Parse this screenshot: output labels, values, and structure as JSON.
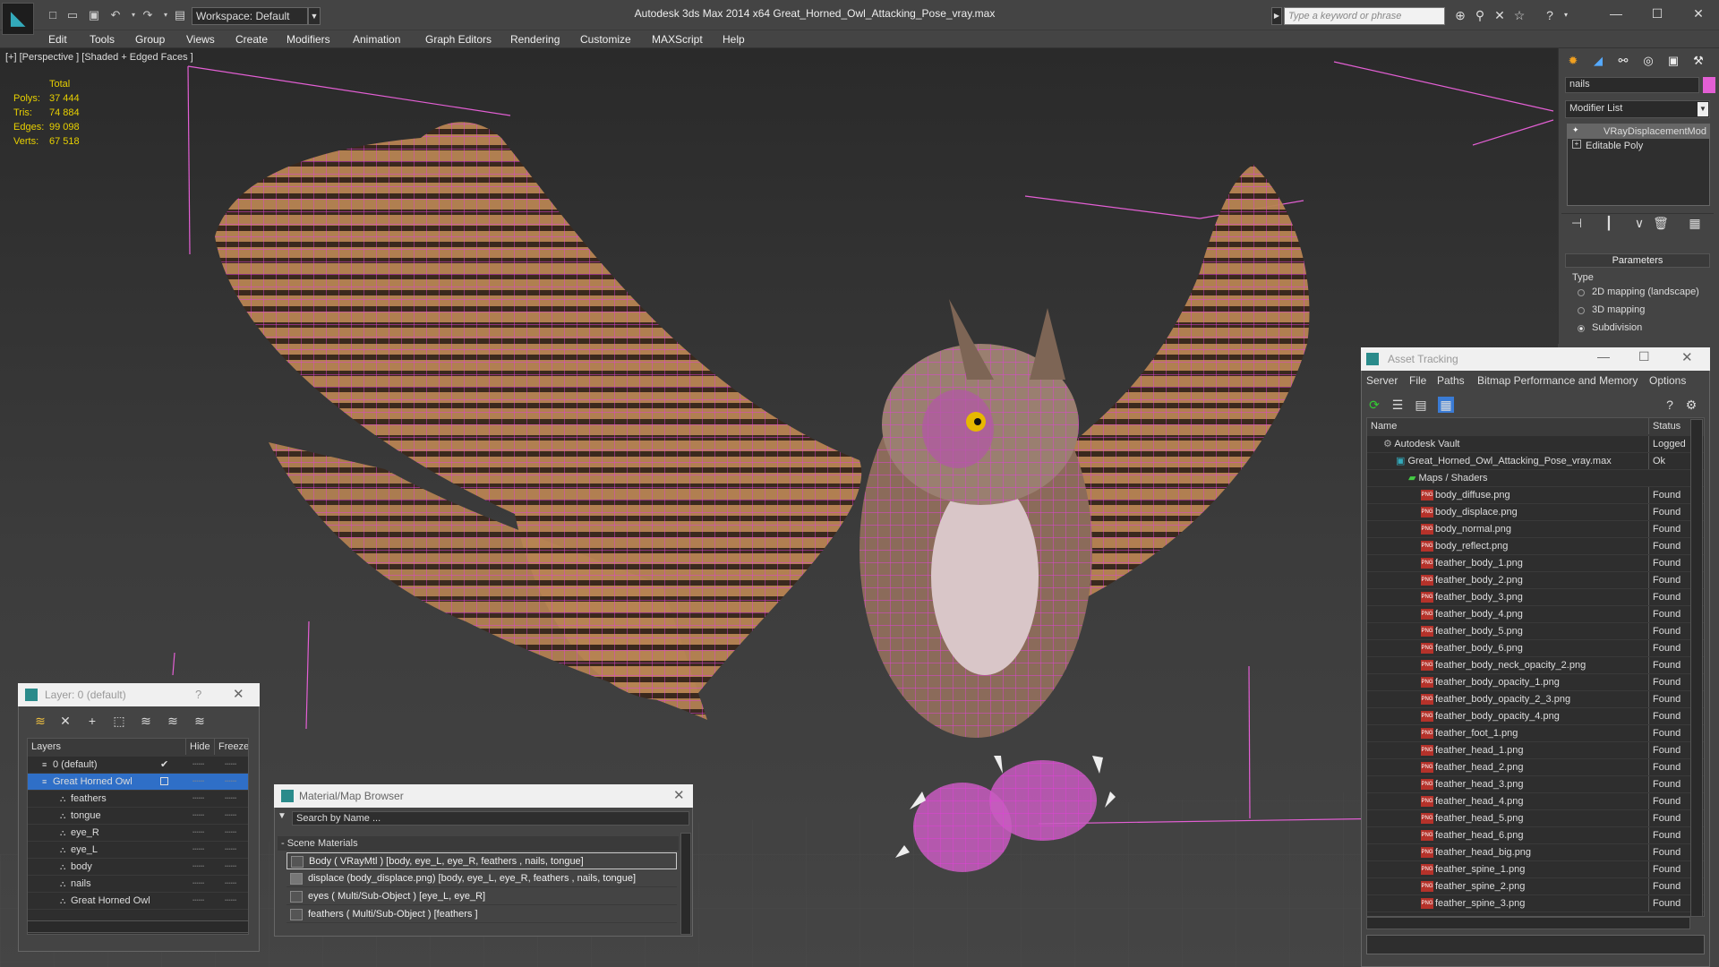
{
  "window": {
    "title": "Autodesk 3ds Max  2014 x64      Great_Horned_Owl_Attacking_Pose_vray.max",
    "workspace": "Workspace: Default",
    "search_placeholder": "Type a keyword or phrase"
  },
  "menu": [
    "Edit",
    "Tools",
    "Group",
    "Views",
    "Create",
    "Modifiers",
    "Animation",
    "Graph Editors",
    "Rendering",
    "Customize",
    "MAXScript",
    "Help"
  ],
  "viewport": {
    "label": "[+] [Perspective ] [Shaded + Edged Faces ]",
    "stats": {
      "header": "Total",
      "rows": [
        {
          "label": "Polys:",
          "value": "37 444"
        },
        {
          "label": "Tris:",
          "value": "74 884"
        },
        {
          "label": "Edges:",
          "value": "99 098"
        },
        {
          "label": "Verts:",
          "value": "67 518"
        }
      ]
    },
    "wireframe_color": "#e040d8"
  },
  "command_panel": {
    "object_name": "nails",
    "object_color": "#e35fd4",
    "modifier_list": "Modifier List",
    "stack": [
      "VRayDisplacementMod",
      "Editable Poly"
    ],
    "parameters_header": "Parameters",
    "type_label": "Type",
    "options": [
      "2D mapping (landscape)",
      "3D mapping",
      "Subdivision"
    ],
    "selected_option": "Subdivision"
  },
  "asset_tracking": {
    "title": "Asset Tracking",
    "menu": [
      "Server",
      "File",
      "Paths",
      "Bitmap Performance and Memory",
      "Options"
    ],
    "col_name": "Name",
    "col_status": "Status",
    "rows": [
      {
        "name": "Autodesk Vault",
        "status": "Logged",
        "indent": 1,
        "kind": "vault"
      },
      {
        "name": "Great_Horned_Owl_Attacking_Pose_vray.max",
        "status": "Ok",
        "indent": 2,
        "kind": "max"
      },
      {
        "name": "Maps / Shaders",
        "status": "",
        "indent": 3,
        "kind": "folder"
      },
      {
        "name": "body_diffuse.png",
        "status": "Found",
        "indent": 4,
        "kind": "png"
      },
      {
        "name": "body_displace.png",
        "status": "Found",
        "indent": 4,
        "kind": "png"
      },
      {
        "name": "body_normal.png",
        "status": "Found",
        "indent": 4,
        "kind": "png"
      },
      {
        "name": "body_reflect.png",
        "status": "Found",
        "indent": 4,
        "kind": "png"
      },
      {
        "name": "feather_body_1.png",
        "status": "Found",
        "indent": 4,
        "kind": "png"
      },
      {
        "name": "feather_body_2.png",
        "status": "Found",
        "indent": 4,
        "kind": "png"
      },
      {
        "name": "feather_body_3.png",
        "status": "Found",
        "indent": 4,
        "kind": "png"
      },
      {
        "name": "feather_body_4.png",
        "status": "Found",
        "indent": 4,
        "kind": "png"
      },
      {
        "name": "feather_body_5.png",
        "status": "Found",
        "indent": 4,
        "kind": "png"
      },
      {
        "name": "feather_body_6.png",
        "status": "Found",
        "indent": 4,
        "kind": "png"
      },
      {
        "name": "feather_body_neck_opacity_2.png",
        "status": "Found",
        "indent": 4,
        "kind": "png"
      },
      {
        "name": "feather_body_opacity_1.png",
        "status": "Found",
        "indent": 4,
        "kind": "png"
      },
      {
        "name": "feather_body_opacity_2_3.png",
        "status": "Found",
        "indent": 4,
        "kind": "png"
      },
      {
        "name": "feather_body_opacity_4.png",
        "status": "Found",
        "indent": 4,
        "kind": "png"
      },
      {
        "name": "feather_foot_1.png",
        "status": "Found",
        "indent": 4,
        "kind": "png"
      },
      {
        "name": "feather_head_1.png",
        "status": "Found",
        "indent": 4,
        "kind": "png"
      },
      {
        "name": "feather_head_2.png",
        "status": "Found",
        "indent": 4,
        "kind": "png"
      },
      {
        "name": "feather_head_3.png",
        "status": "Found",
        "indent": 4,
        "kind": "png"
      },
      {
        "name": "feather_head_4.png",
        "status": "Found",
        "indent": 4,
        "kind": "png"
      },
      {
        "name": "feather_head_5.png",
        "status": "Found",
        "indent": 4,
        "kind": "png"
      },
      {
        "name": "feather_head_6.png",
        "status": "Found",
        "indent": 4,
        "kind": "png"
      },
      {
        "name": "feather_head_big.png",
        "status": "Found",
        "indent": 4,
        "kind": "png"
      },
      {
        "name": "feather_spine_1.png",
        "status": "Found",
        "indent": 4,
        "kind": "png"
      },
      {
        "name": "feather_spine_2.png",
        "status": "Found",
        "indent": 4,
        "kind": "png"
      },
      {
        "name": "feather_spine_3.png",
        "status": "Found",
        "indent": 4,
        "kind": "png"
      }
    ]
  },
  "layer_dialog": {
    "title": "Layer: 0 (default)",
    "help": "?",
    "col_layers": "Layers",
    "col_hide": "Hide",
    "col_freeze": "Freeze",
    "rows": [
      {
        "name": "0 (default)",
        "indent": 1,
        "selected": false,
        "active": true
      },
      {
        "name": "Great Horned Owl",
        "indent": 1,
        "selected": true,
        "active": false
      },
      {
        "name": "feathers",
        "indent": 2,
        "selected": false,
        "active": false
      },
      {
        "name": "tongue",
        "indent": 2,
        "selected": false,
        "active": false
      },
      {
        "name": "eye_R",
        "indent": 2,
        "selected": false,
        "active": false
      },
      {
        "name": "eye_L",
        "indent": 2,
        "selected": false,
        "active": false
      },
      {
        "name": "body",
        "indent": 2,
        "selected": false,
        "active": false
      },
      {
        "name": "nails",
        "indent": 2,
        "selected": false,
        "active": false
      },
      {
        "name": "Great Horned Owl",
        "indent": 2,
        "selected": false,
        "active": false
      }
    ]
  },
  "material_browser": {
    "title": "Material/Map Browser",
    "search": "Search by Name ...",
    "group": "- Scene Materials",
    "rows": [
      "Body  ( VRayMtl )  [body, eye_L, eye_R, feathers , nails, tongue]",
      "displace (body_displace.png) [body, eye_L, eye_R, feathers , nails, tongue]",
      "eyes  ( Multi/Sub-Object )  [eye_L, eye_R]",
      "feathers  ( Multi/Sub-Object )  [feathers ]"
    ]
  }
}
